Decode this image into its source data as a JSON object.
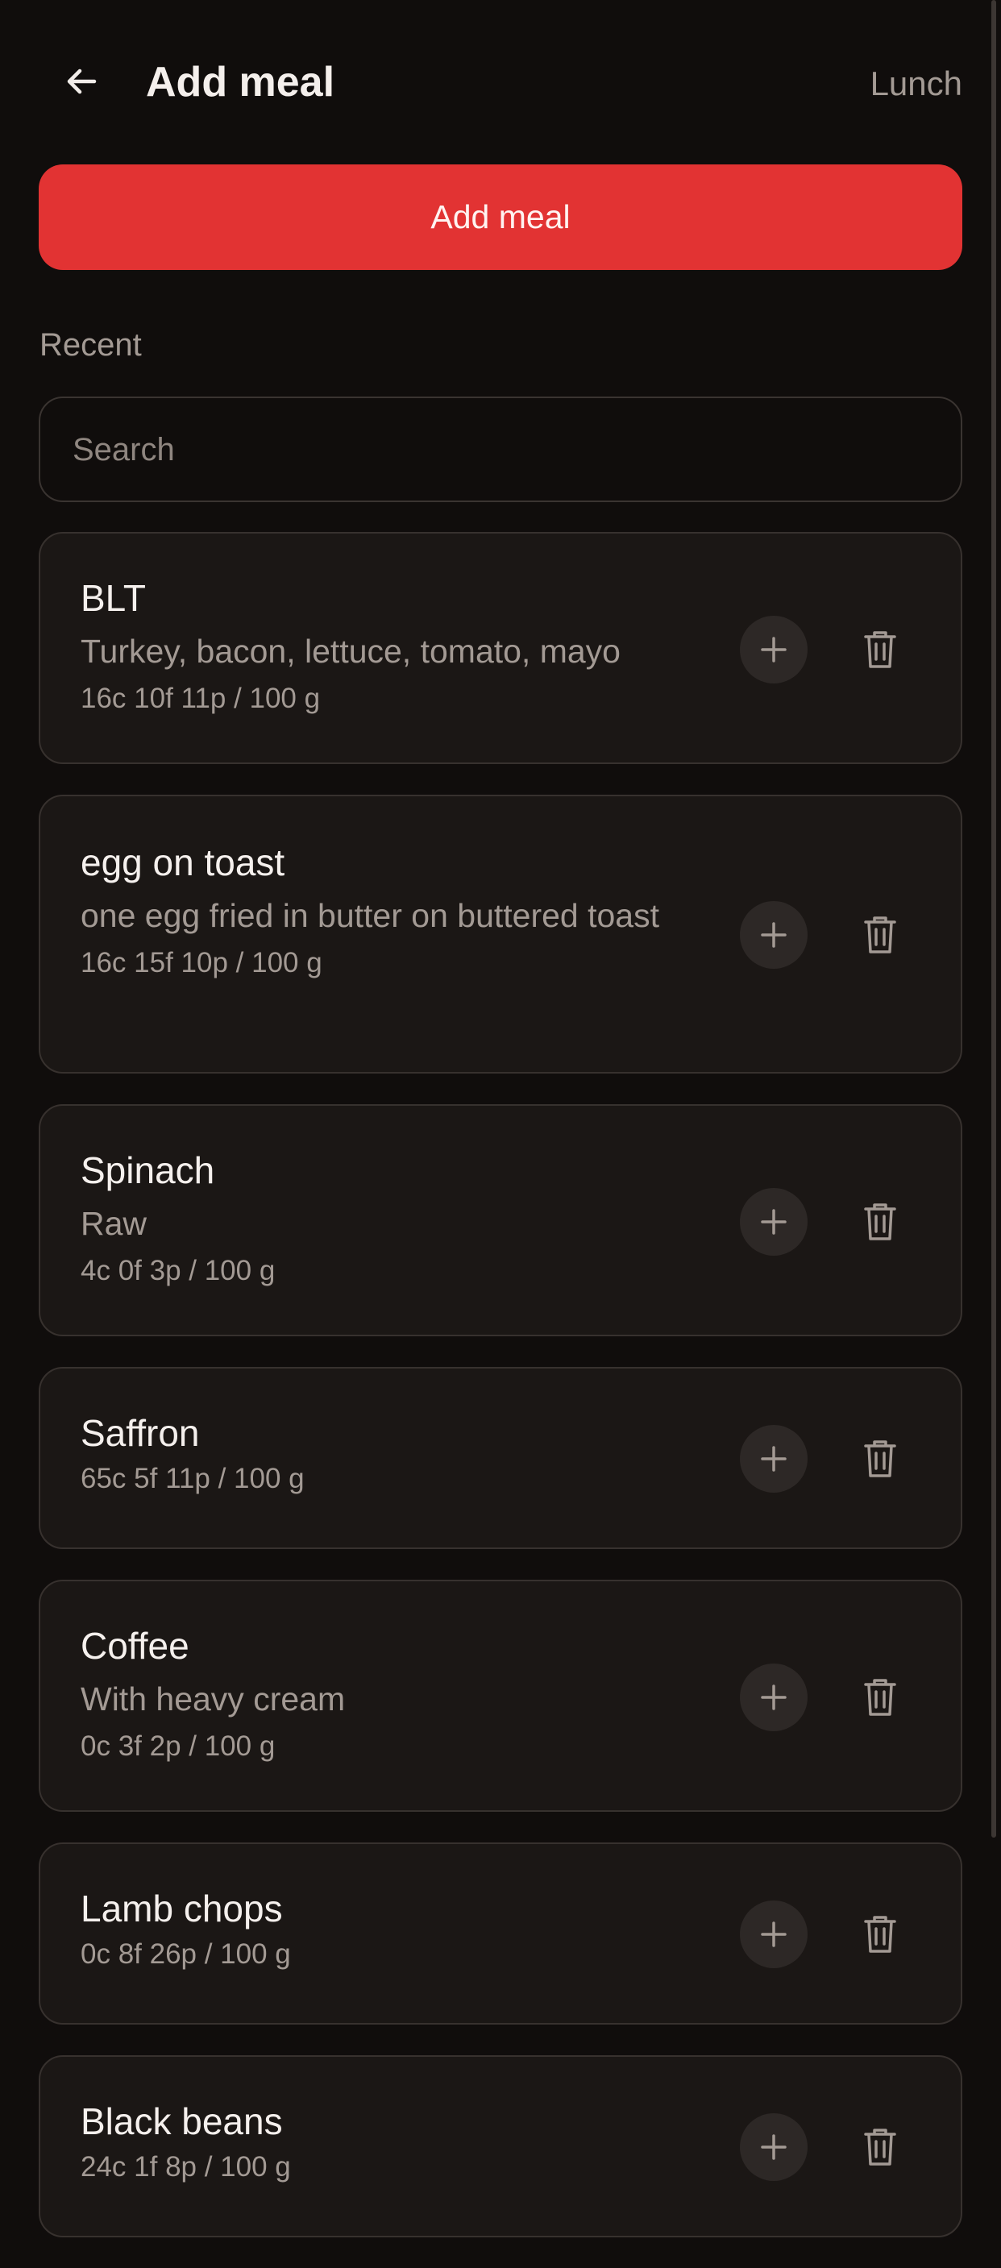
{
  "header": {
    "title": "Add meal",
    "meal_type": "Lunch"
  },
  "add_button": {
    "label": "Add meal"
  },
  "section": {
    "label": "Recent"
  },
  "search": {
    "placeholder": "Search",
    "value": ""
  },
  "icons": {
    "back": "arrow-left-icon",
    "add": "plus-icon",
    "delete": "trash-icon"
  },
  "colors": {
    "background": "#100d0c",
    "card": "#1b1715",
    "accent": "#e23333",
    "muted_text": "#a39a94"
  },
  "meals": [
    {
      "name": "BLT",
      "description": "Turkey, bacon, lettuce, tomato, mayo",
      "macros": "16c 10f 11p / 100 g"
    },
    {
      "name": "egg on toast",
      "description": "one egg fried in butter on buttered toast",
      "macros": "16c 15f 10p / 100 g"
    },
    {
      "name": "Spinach",
      "description": "Raw",
      "macros": "4c 0f 3p / 100 g"
    },
    {
      "name": "Saffron",
      "description": "",
      "macros": "65c 5f 11p / 100 g"
    },
    {
      "name": "Coffee",
      "description": "With heavy cream",
      "macros": "0c 3f 2p / 100 g"
    },
    {
      "name": "Lamb chops",
      "description": "",
      "macros": "0c 8f 26p / 100 g"
    },
    {
      "name": "Black beans",
      "description": "",
      "macros": "24c 1f 8p / 100 g"
    }
  ]
}
